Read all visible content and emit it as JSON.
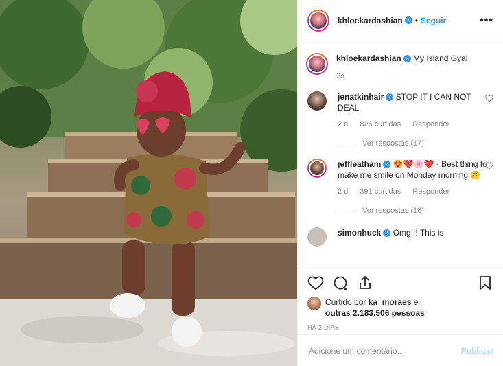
{
  "header": {
    "username": "khloekardashian",
    "separator": "•",
    "follow_label": "Seguir",
    "more_label": "•••"
  },
  "post": {
    "caption_user": "khloekardashian",
    "caption_text": "My Island Gyal",
    "caption_time": "2d"
  },
  "comments": [
    {
      "user": "jenatkinhair",
      "text": "STOP IT I CAN NOT DEAL",
      "time": "2 d",
      "likes": "826 curtidas",
      "reply_label": "Responder",
      "view_replies": "Ver respostas (17)"
    },
    {
      "user": "jeffleatham",
      "text": "😍❤️🌸❤️ - Best thing to make me smile on Monday morning 🙃",
      "time": "2 d",
      "likes": "391 curtidas",
      "reply_label": "Responder",
      "view_replies": "Ver respostas (16)"
    },
    {
      "user": "simonhuck",
      "text": "Omg!!! This is"
    }
  ],
  "likes_summary": {
    "prefix": "Curtido por ",
    "user": "ka_moraes",
    "suffix": " e",
    "others": "outras 2.183.506 pessoas"
  },
  "posted_ago": "HÁ 2 DIAS",
  "composer": {
    "placeholder": "Adicione um comentário...",
    "publish_label": "Publicar"
  },
  "icons": [
    "heart-icon",
    "comment-icon",
    "share-icon",
    "bookmark-icon",
    "verified-icon",
    "more-icon"
  ]
}
